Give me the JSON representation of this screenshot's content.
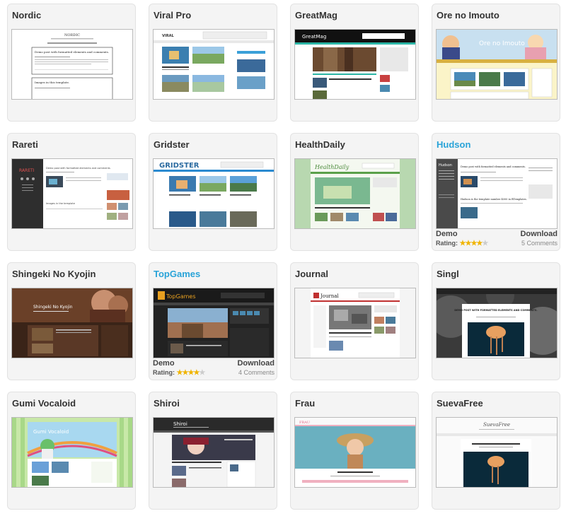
{
  "themes": [
    {
      "name": "Nordic",
      "link": false
    },
    {
      "name": "Viral Pro",
      "link": false
    },
    {
      "name": "GreatMag",
      "link": false
    },
    {
      "name": "Ore no Imouto",
      "link": false
    },
    {
      "name": "Rareti",
      "link": false
    },
    {
      "name": "Gridster",
      "link": false
    },
    {
      "name": "HealthDaily",
      "link": false
    },
    {
      "name": "Hudson",
      "link": true,
      "demo": "Demo",
      "download": "Download",
      "rating_label": "Rating:",
      "rating": 3.5,
      "comments": "5 Comments"
    },
    {
      "name": "Shingeki No Kyojin",
      "link": false
    },
    {
      "name": "TopGames",
      "link": true,
      "demo": "Demo",
      "download": "Download",
      "rating_label": "Rating:",
      "rating": 3.5,
      "comments": "4 Comments"
    },
    {
      "name": "Journal",
      "link": false
    },
    {
      "name": "Singl",
      "link": false
    },
    {
      "name": "Gumi Vocaloid",
      "link": false
    },
    {
      "name": "Shiroi",
      "link": false
    },
    {
      "name": "Frau",
      "link": false
    },
    {
      "name": "SuevaFree",
      "link": false
    }
  ],
  "previews": {
    "nordic": {
      "brand": "NORDIC",
      "post1": "Demo post with formatted elements and comments.",
      "post2": "Images in this template."
    },
    "viral": {
      "brand": "VIRAL",
      "post": "Demo post with formatted elements and comments"
    },
    "greatmag": {
      "brand": "GreatMag"
    },
    "ore": {
      "brand": "Ore no Imouto"
    },
    "rareti": {
      "brand": "RARETI",
      "post1": "Demo post with formatted elements and comments",
      "post2": "Images in the template"
    },
    "gridster": {
      "brand": "GRIDSTER"
    },
    "healthdaily": {
      "brand": "HealthDaily"
    },
    "hudson": {
      "brand": "Hudson",
      "post1": "Demo post with formatted elements and comments.",
      "post2": "Hudson is the template number 4000 in BTemplates."
    },
    "shingeki": {
      "brand": "Shingeki No Kyojin"
    },
    "topgames": {
      "brand": "TopGames"
    },
    "journal": {
      "brand": "Journal"
    },
    "singl": {
      "post": "DEMO POST WITH FORMATTED ELEMENTS AND COMMENTS."
    },
    "gumi": {
      "brand": "Gumi Vocaloid"
    },
    "shiroi": {
      "brand": "Shiroi"
    },
    "frau": {
      "brand": "FRAU"
    },
    "sueva": {
      "brand": "SuevaFree"
    }
  },
  "colors": {
    "link": "#29a3d8",
    "star": "#f0b400"
  }
}
